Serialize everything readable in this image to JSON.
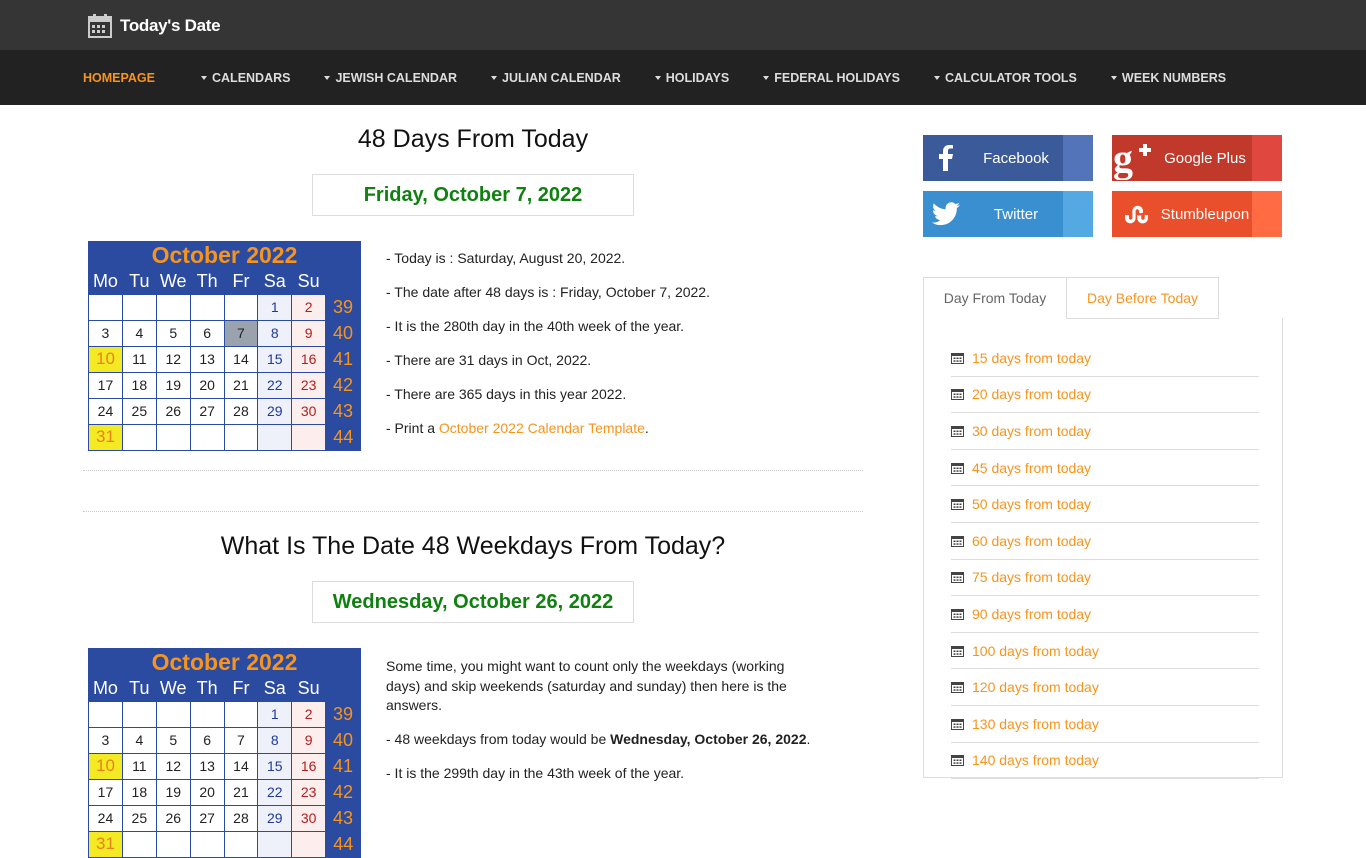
{
  "brand": {
    "title": "Today's Date"
  },
  "nav": [
    {
      "label": "HOMEPAGE",
      "active": true,
      "dropdown": false
    },
    {
      "label": "CALENDARS",
      "dropdown": true
    },
    {
      "label": "JEWISH CALENDAR",
      "dropdown": true
    },
    {
      "label": "JULIAN CALENDAR",
      "dropdown": true
    },
    {
      "label": "HOLIDAYS",
      "dropdown": true
    },
    {
      "label": "FEDERAL HOLIDAYS",
      "dropdown": true
    },
    {
      "label": "CALCULATOR TOOLS",
      "dropdown": true
    },
    {
      "label": "WEEK NUMBERS",
      "dropdown": true
    }
  ],
  "section1": {
    "title": "48 Days From Today",
    "result": "Friday, October 7, 2022",
    "info": [
      "- Today is : Saturday, August 20, 2022.",
      "- The date after 48 days is : Friday, October 7, 2022.",
      "- It is the 280th day in the 40th week of the year.",
      "- There are 31 days in Oct, 2022.",
      "- There are 365 days in this year 2022."
    ],
    "print_prefix": "- Print a ",
    "print_link": "October 2022 Calendar Template",
    "print_suffix": "."
  },
  "section2": {
    "title": "What Is The Date 48 Weekdays From Today?",
    "result": "Wednesday, October 26, 2022",
    "intro": "Some time, you might want to count only the weekdays (working days) and skip weekends (saturday and sunday) then here is the answers.",
    "line_prefix": "- 48 weekdays from today would be ",
    "line_bold": "Wednesday, October 26, 2022",
    "line_suffix": ".",
    "cut_line": "- It is the 299th day in the 43th week of the year."
  },
  "calendar": {
    "title": "October 2022",
    "days_of_week": [
      "Mo",
      "Tu",
      "We",
      "Th",
      "Fr",
      "Sa",
      "Su"
    ],
    "weeks": [
      {
        "num": "39",
        "days": [
          "",
          "",
          "",
          "",
          "",
          "1",
          "2"
        ]
      },
      {
        "num": "40",
        "days": [
          "3",
          "4",
          "5",
          "6",
          "7",
          "8",
          "9"
        ]
      },
      {
        "num": "41",
        "days": [
          "10",
          "11",
          "12",
          "13",
          "14",
          "15",
          "16"
        ]
      },
      {
        "num": "42",
        "days": [
          "17",
          "18",
          "19",
          "20",
          "21",
          "22",
          "23"
        ]
      },
      {
        "num": "43",
        "days": [
          "24",
          "25",
          "26",
          "27",
          "28",
          "29",
          "30"
        ]
      },
      {
        "num": "44",
        "days": [
          "31",
          "",
          "",
          "",
          "",
          "",
          ""
        ]
      }
    ],
    "cal1_marked_day": "7",
    "yellow_days": [
      "10",
      "31"
    ]
  },
  "social": {
    "facebook": "Facebook",
    "google": "Google Plus",
    "twitter": "Twitter",
    "stumble": "Stumbleupon"
  },
  "tabs": {
    "active": "Day From Today",
    "other": "Day Before Today"
  },
  "day_links": [
    "15 days from today",
    "20 days from today",
    "30 days from today",
    "45 days from today",
    "50 days from today",
    "60 days from today",
    "75 days from today",
    "90 days from today",
    "100 days from today",
    "120 days from today",
    "130 days from today",
    "140 days from today"
  ],
  "colors": {
    "accent": "#f7941d",
    "result_green": "#108010",
    "calendar_blue": "#2b4ba0"
  }
}
